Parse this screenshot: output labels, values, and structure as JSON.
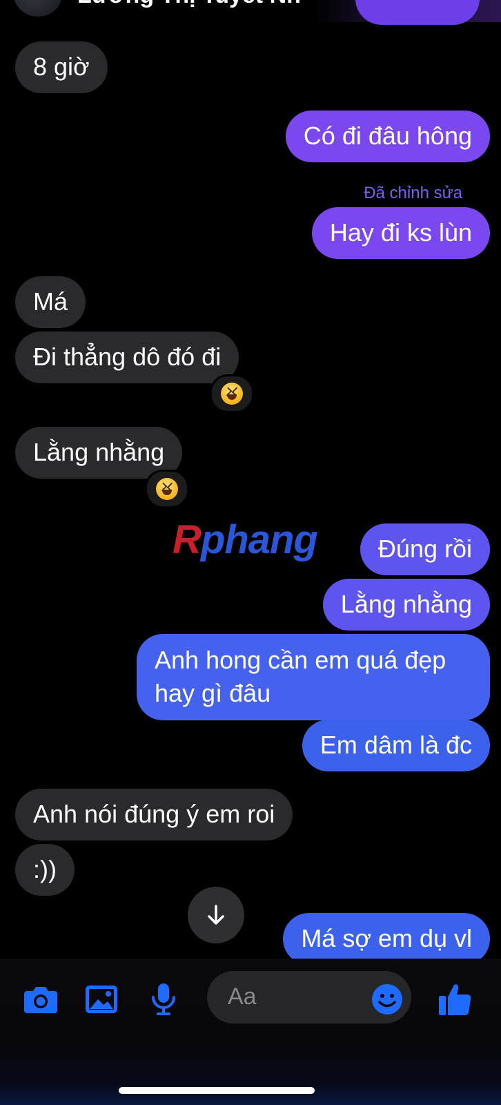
{
  "header": {
    "contact_name": "Lương Thị Tuyết Nh"
  },
  "messages": [
    {
      "text": "8 giờ",
      "direction": "incoming"
    },
    {
      "text": "Có đi đâu hông",
      "direction": "outgoing"
    },
    {
      "text": "Hay đi ks lùn",
      "direction": "outgoing",
      "status": "Đã chỉnh sửa"
    },
    {
      "text": "Má",
      "direction": "incoming"
    },
    {
      "text": "Đi thẳng dô đó đi",
      "direction": "incoming",
      "reaction": "laughing-face"
    },
    {
      "text": "Lằng nhằng",
      "direction": "incoming",
      "reaction": "laughing-face"
    },
    {
      "text": "Đúng rồi",
      "direction": "outgoing"
    },
    {
      "text": "Lằng nhằng",
      "direction": "outgoing"
    },
    {
      "text": "Anh hong cần em quá đẹp hay gì đâu",
      "direction": "outgoing"
    },
    {
      "text": "Em dâm là đc",
      "direction": "outgoing"
    },
    {
      "text": "Anh nói đúng ý em roi",
      "direction": "incoming"
    },
    {
      "text": ":))",
      "direction": "incoming"
    },
    {
      "text": "Má sợ em dụ vl",
      "direction": "outgoing"
    }
  ],
  "watermark": {
    "first": "R",
    "rest": "phang"
  },
  "composer": {
    "placeholder": "Aa",
    "icons": [
      "camera-icon",
      "gallery-icon",
      "microphone-icon",
      "emoji-icon",
      "thumbs-up-icon"
    ]
  },
  "colors": {
    "incoming_bubble": "#2a2a2c",
    "outgoing_purple": "#7a48ee",
    "outgoing_blue": "#4462ee",
    "accent_blue": "#1f6bff",
    "edited_label": "#7a60f0"
  }
}
